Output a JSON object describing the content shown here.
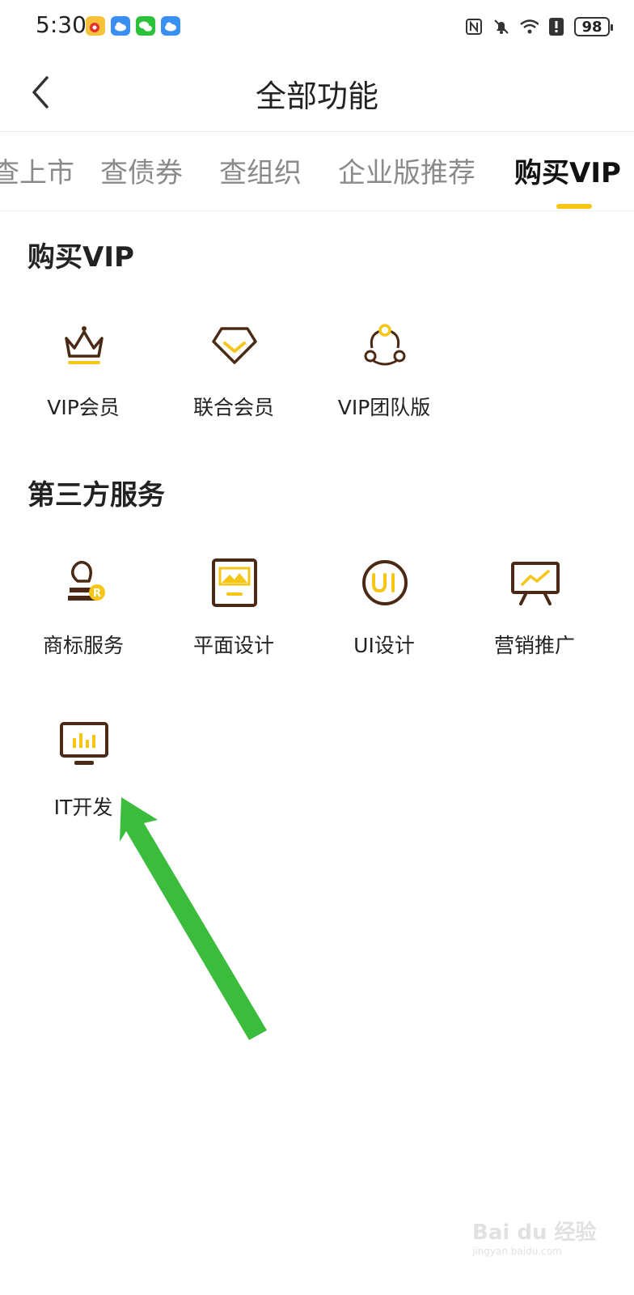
{
  "status_bar": {
    "time": "5:30",
    "battery": "98",
    "apps": [
      "weibo-icon",
      "cloud-icon",
      "wechat-icon",
      "cloud-icon"
    ]
  },
  "nav": {
    "title": "全部功能",
    "back_icon": "chevron-left-icon"
  },
  "tabs": [
    {
      "label": "查上市",
      "active": false
    },
    {
      "label": "查债券",
      "active": false
    },
    {
      "label": "查组织",
      "active": false
    },
    {
      "label": "企业版推荐",
      "active": false
    },
    {
      "label": "购买VIP",
      "active": true
    }
  ],
  "sections": [
    {
      "title": "购买VIP",
      "items": [
        {
          "label": "VIP会员",
          "icon": "crown-icon"
        },
        {
          "label": "联合会员",
          "icon": "diamond-icon"
        },
        {
          "label": "VIP团队版",
          "icon": "team-icon"
        }
      ]
    },
    {
      "title": "第三方服务",
      "items": [
        {
          "label": "商标服务",
          "icon": "trademark-icon"
        },
        {
          "label": "平面设计",
          "icon": "image-frame-icon"
        },
        {
          "label": "UI设计",
          "icon": "ui-icon"
        },
        {
          "label": "营销推广",
          "icon": "presentation-icon"
        },
        {
          "label": "IT开发",
          "icon": "monitor-chart-icon"
        }
      ]
    }
  ],
  "colors": {
    "accent": "#f5c518",
    "icon_brown": "#4a2a14",
    "arrow_green": "#3cbc3c"
  },
  "watermark": {
    "text": "Bai du 经验",
    "sub": "jingyan.baidu.com"
  }
}
